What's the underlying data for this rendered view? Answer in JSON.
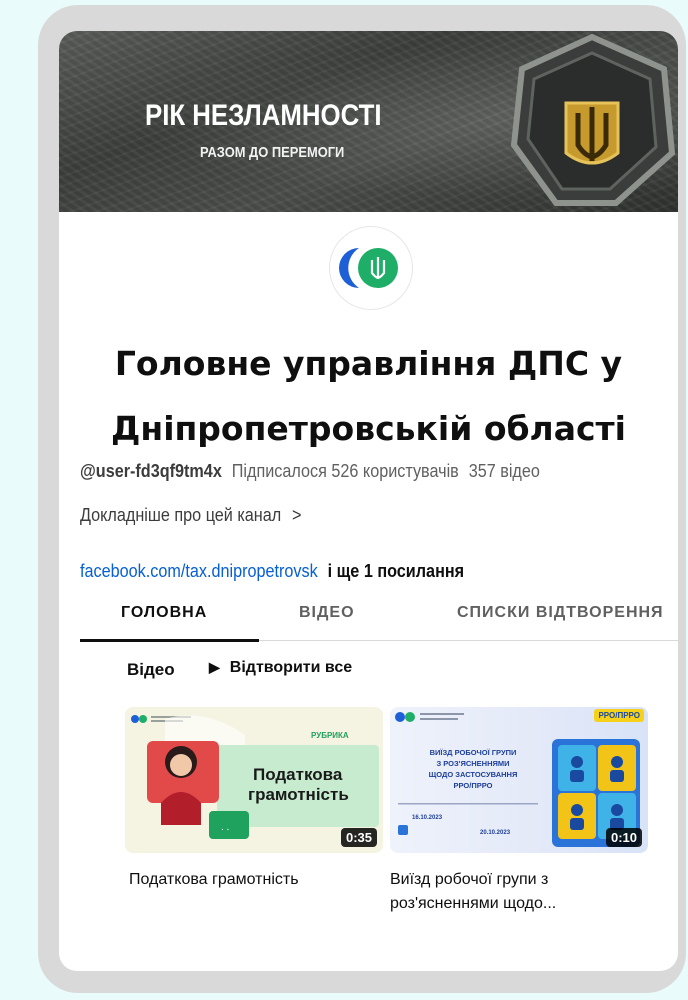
{
  "banner": {
    "title": "РІК НЕЗЛАМНОСТІ",
    "subtitle": "РАЗОМ ДО ПЕРЕМОГИ"
  },
  "channel": {
    "name_line1": "Головне управління ДПС у",
    "name_line2": "Дніпропетровській області",
    "handle": "@user-fd3qf9tm4x",
    "subscribers": "Підписалося 526 користувачів",
    "videos": "357 відео",
    "about": "Докладніше про цей канал",
    "link": "facebook.com/tax.dnipropetrovsk",
    "link_more": "і ще 1 посилання"
  },
  "tabs": [
    {
      "label": "ГОЛОВНА",
      "active": true
    },
    {
      "label": "ВІДЕО",
      "active": false
    },
    {
      "label": "СПИСКИ ВІДТВОРЕННЯ",
      "active": false
    }
  ],
  "section": {
    "title": "Відео",
    "play_all": "Відтворити все"
  },
  "videos": [
    {
      "title": "Податкова грамотність",
      "duration": "0:35",
      "thumb_heading": "РУБРИКА",
      "thumb_text_1": "Податкова",
      "thumb_text_2": "грамотність"
    },
    {
      "title_line1": "Виїзд робочої групи з",
      "title_line2": "роз'ясненнями щодо...",
      "duration": "0:10",
      "thumb_badge": "РРО/ПРРО",
      "thumb_lines": [
        "ВИЇЗД РОБОЧОЇ ГРУПИ",
        "З РОЗ'ЯСНЕННЯМИ",
        "ЩОДО ЗАСТОСУВАННЯ",
        "РРО/ПРРО"
      ],
      "thumb_date_from": "16.10.2023",
      "thumb_date_to": "20.10.2023"
    }
  ],
  "colors": {
    "link": "#065fd4",
    "brand_blue": "#1c5fd6",
    "brand_green": "#1fae68"
  }
}
